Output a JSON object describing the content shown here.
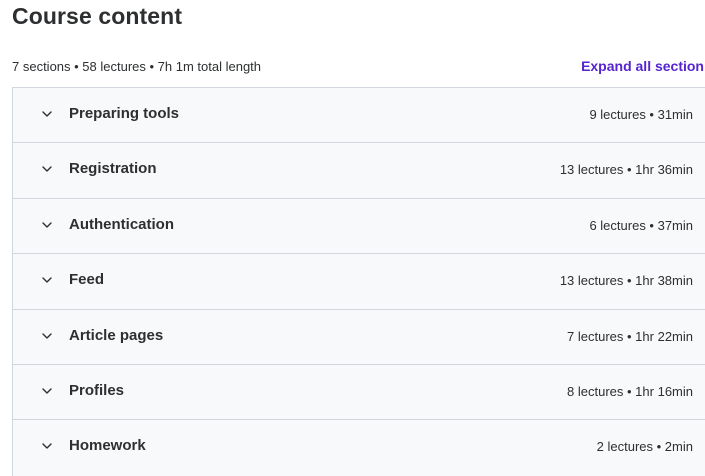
{
  "header": {
    "title": "Course content",
    "summary": "7 sections • 58 lectures • 7h 1m total length",
    "expand_label": "Expand all section"
  },
  "icons": {
    "section_toggle": "chevron-down-icon"
  },
  "colors": {
    "accent": "#5624d0",
    "section_bg": "#f7f9fa",
    "border": "#d1d7dc",
    "text": "#2d2f31"
  },
  "sections": [
    {
      "title": "Preparing tools",
      "meta": "9 lectures • 31min"
    },
    {
      "title": "Registration",
      "meta": "13 lectures • 1hr 36min"
    },
    {
      "title": "Authentication",
      "meta": "6 lectures • 37min"
    },
    {
      "title": "Feed",
      "meta": "13 lectures • 1hr 38min"
    },
    {
      "title": "Article pages",
      "meta": "7 lectures • 1hr 22min"
    },
    {
      "title": "Profiles",
      "meta": "8 lectures • 1hr 16min"
    },
    {
      "title": "Homework",
      "meta": "2 lectures • 2min"
    }
  ]
}
